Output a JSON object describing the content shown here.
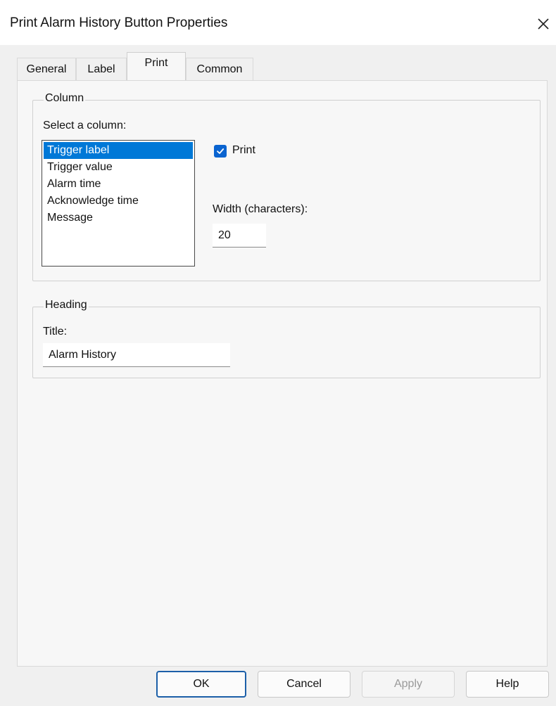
{
  "window": {
    "title": "Print Alarm History Button Properties",
    "close_icon": "close-icon"
  },
  "tabs": [
    {
      "label": "General",
      "active": false
    },
    {
      "label": "Label",
      "active": false
    },
    {
      "label": "Print",
      "active": true
    },
    {
      "label": "Common",
      "active": false
    }
  ],
  "column_group": {
    "label": "Column",
    "select_label": "Select a column:",
    "items": [
      "Trigger label",
      "Trigger value",
      "Alarm time",
      "Acknowledge time",
      "Message"
    ],
    "selected": "Trigger label",
    "print_checkbox": {
      "label": "Print",
      "checked": true
    },
    "width_label": "Width (characters):",
    "width_value": "20"
  },
  "heading_group": {
    "label": "Heading",
    "title_label": "Title:",
    "title_value": "Alarm History"
  },
  "buttons": {
    "ok": "OK",
    "cancel": "Cancel",
    "apply": "Apply",
    "help": "Help"
  },
  "colors": {
    "selection": "#0078d7",
    "checkbox": "#0a64d0",
    "default_button_border": "#1c5fa8"
  }
}
